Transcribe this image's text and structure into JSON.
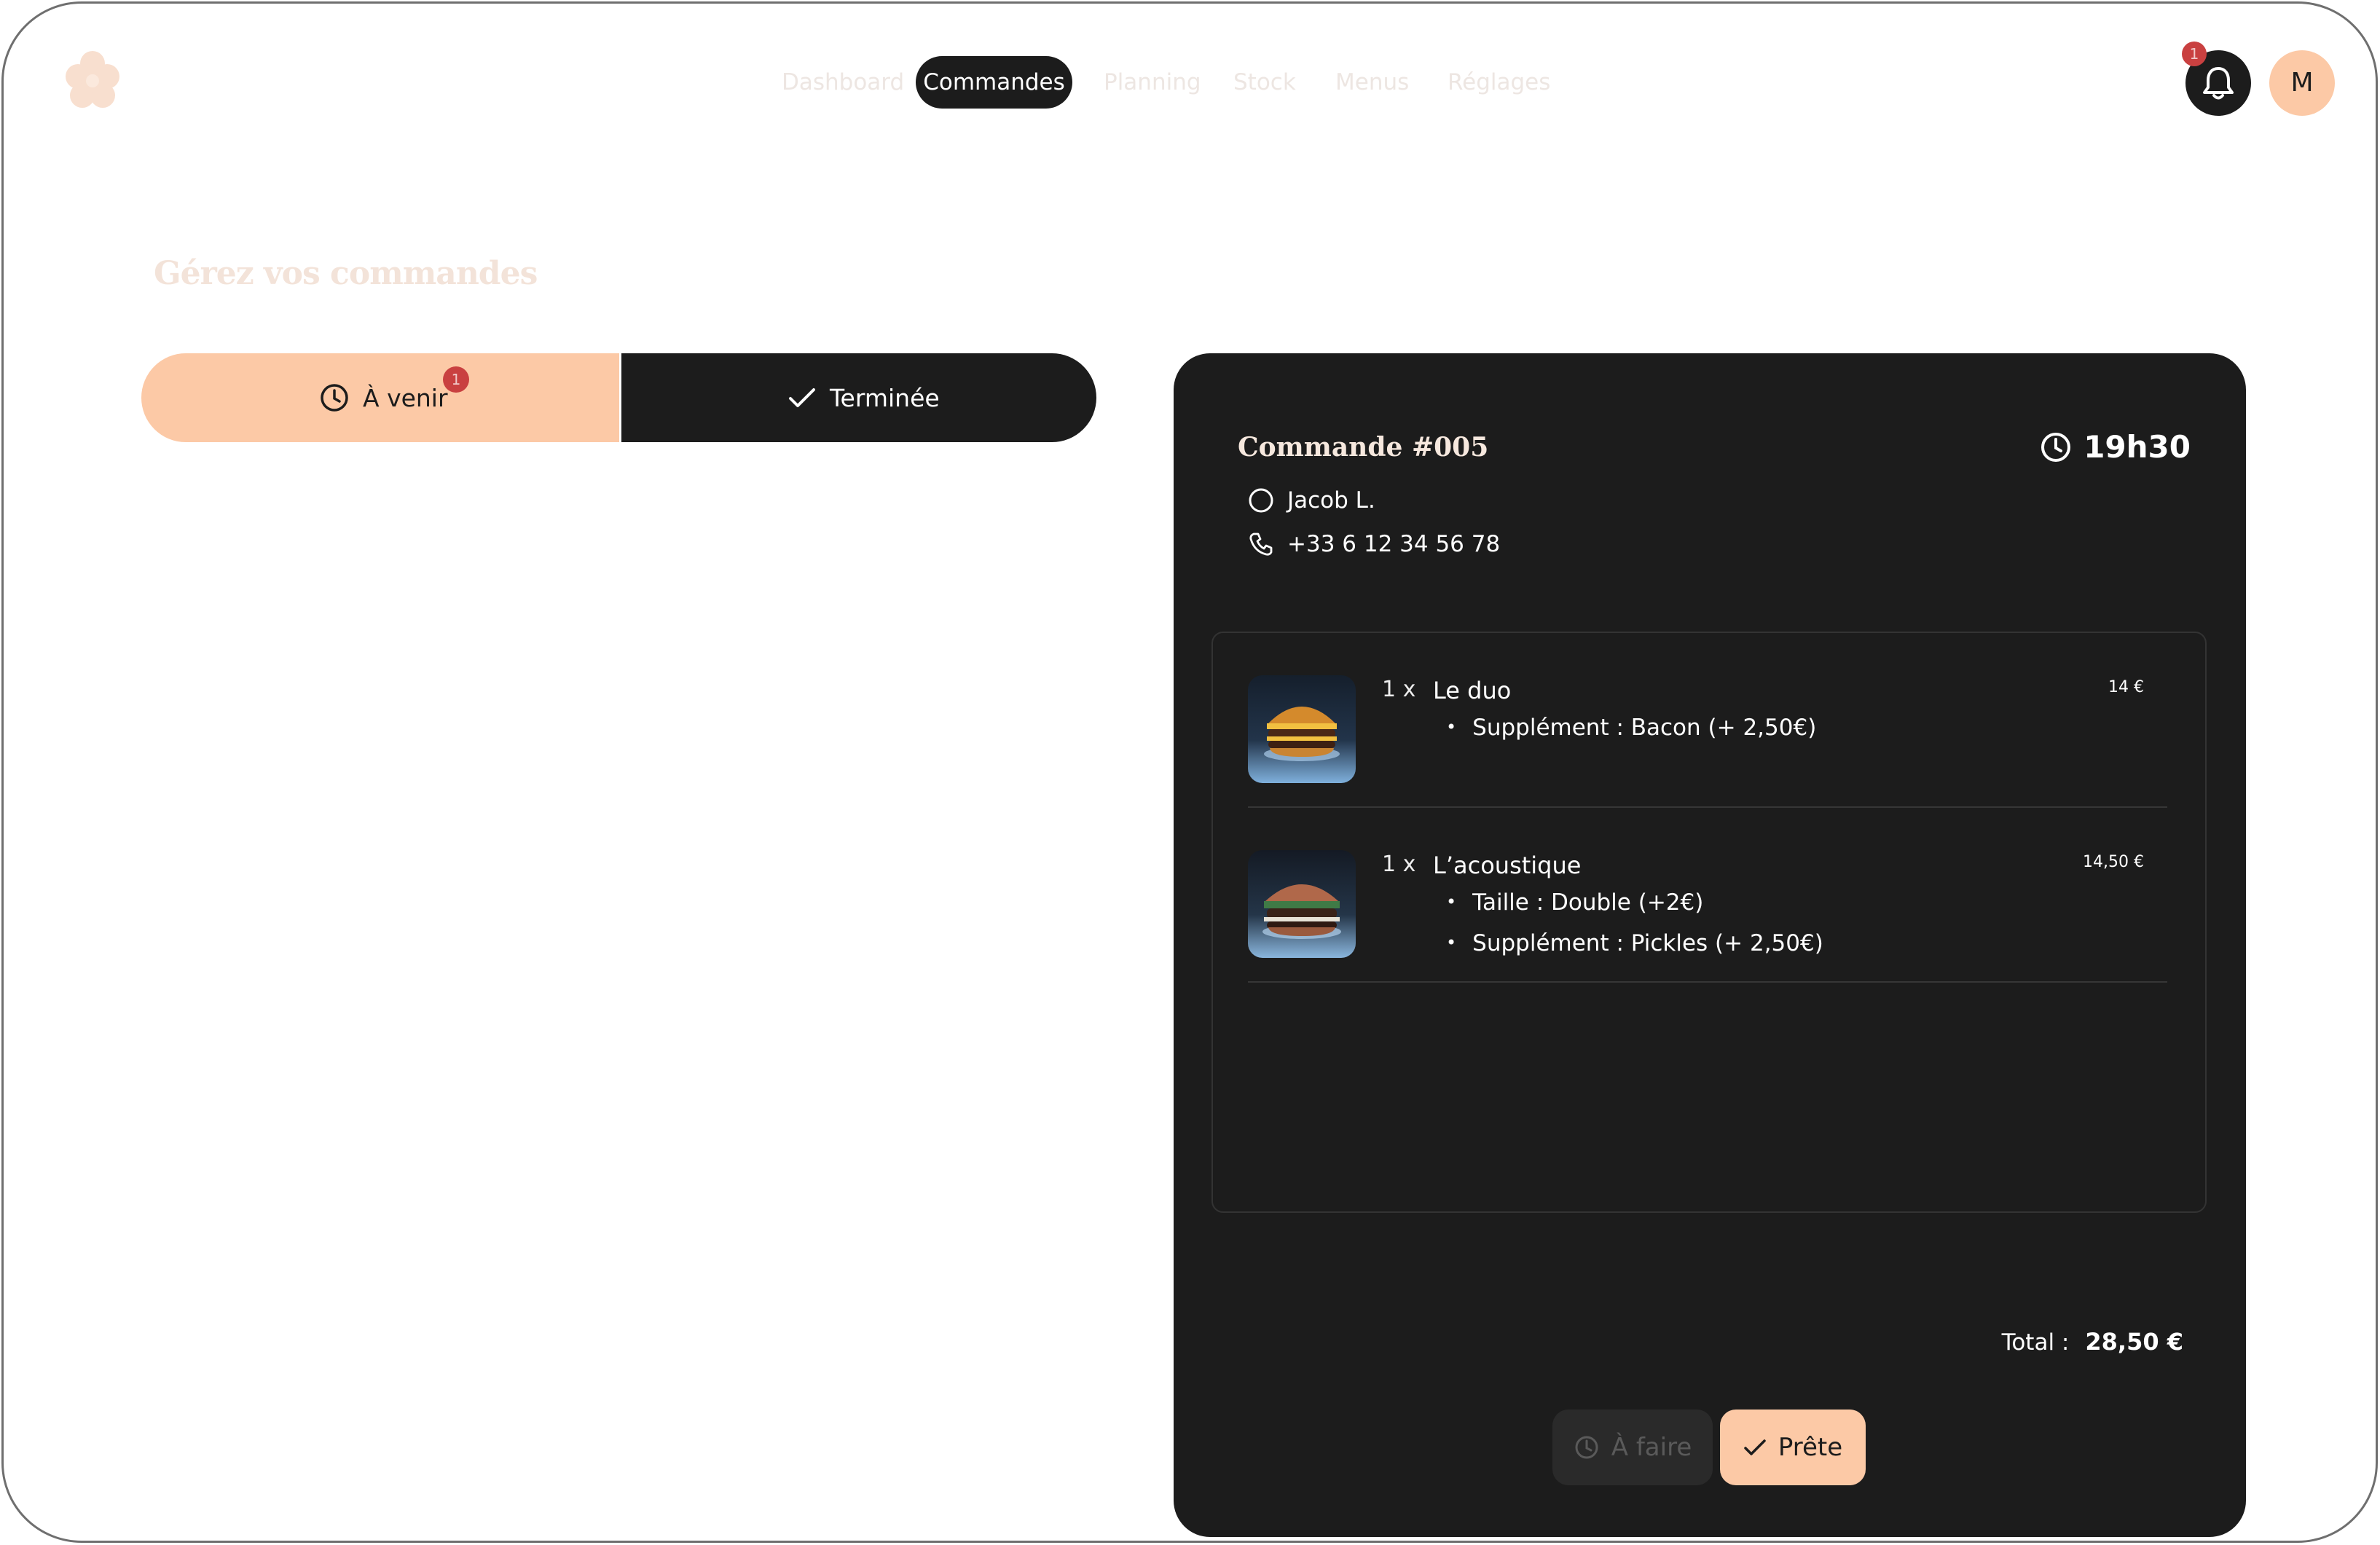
{
  "app": {
    "logo_icon": "flower-icon",
    "brand_color": "#fcc9a6",
    "dark_color": "#1c1c1c",
    "alert_color": "#c94040"
  },
  "nav": {
    "items": [
      {
        "label": "Dashboard"
      },
      {
        "label": "Commandes",
        "active": true
      },
      {
        "label": "Planning"
      },
      {
        "label": "Stock"
      },
      {
        "label": "Menus"
      },
      {
        "label": "Réglages"
      }
    ]
  },
  "header": {
    "notification_count": "1",
    "avatar_initial": "M"
  },
  "page": {
    "title": "Gérez vos commandes"
  },
  "filters": {
    "upcoming_label": "À venir",
    "upcoming_count": "1",
    "done_label": "Terminée"
  },
  "order": {
    "title": "Commande #005",
    "time": "19h30",
    "customer_name": "Jacob L.",
    "customer_phone": "+33 6 12 34 56 78",
    "items": [
      {
        "qty": "1 x",
        "name": "Le duo",
        "price": "14 €",
        "options": [
          "Supplément : Bacon (+ 2,50€)"
        ]
      },
      {
        "qty": "1 x",
        "name": "L’acoustique",
        "price": "14,50 €",
        "options": [
          "Taille : Double (+2€)",
          "Supplément : Pickles (+ 2,50€)"
        ]
      }
    ],
    "total_label": "Total :",
    "total_value": "28,50 €",
    "btn_todo_label": "À faire",
    "btn_ready_label": "Prête"
  }
}
